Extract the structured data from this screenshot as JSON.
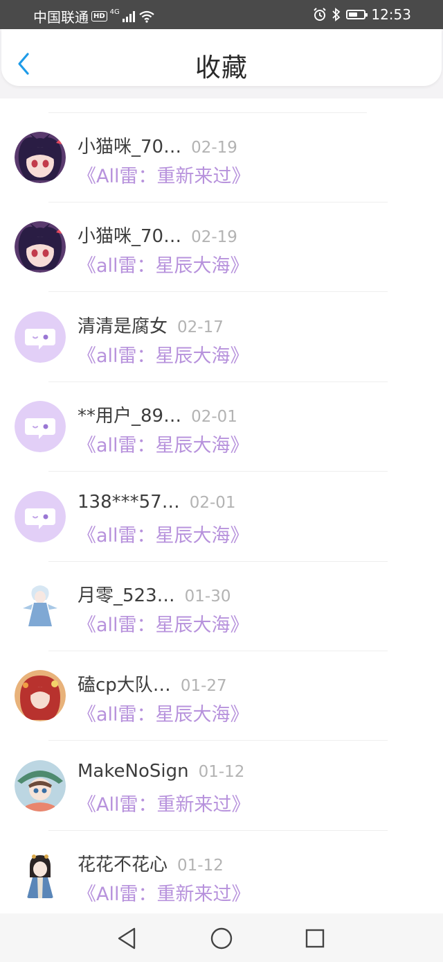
{
  "status_bar": {
    "carrier": "中国联通",
    "hd_badge": "HD",
    "network_type": "4G",
    "time": "12:53",
    "icons": [
      "signal-icon",
      "wifi-icon",
      "alarm-icon",
      "bluetooth-icon",
      "battery-icon"
    ]
  },
  "header": {
    "title": "收藏",
    "back_icon": "chevron-left-icon",
    "accent_color": "#1e9be8"
  },
  "colors": {
    "name": "#3d3d3d",
    "date": "#b3b3b3",
    "item_title": "#b792dc",
    "default_avatar_bg": "#e2cff7"
  },
  "items": [
    {
      "name": "小猫咪_70…",
      "date": "02-19",
      "title": "《All雷：重新来过》",
      "avatar": "anime-cat-girl-avatar"
    },
    {
      "name": "小猫咪_70…",
      "date": "02-19",
      "title": "《all雷：星辰大海》",
      "avatar": "anime-cat-girl-avatar"
    },
    {
      "name": "清清是腐女",
      "date": "02-17",
      "title": "《all雷：星辰大海》",
      "avatar": "default-chat-avatar"
    },
    {
      "name": "**用户_89…",
      "date": "02-01",
      "title": "《all雷：星辰大海》",
      "avatar": "default-chat-avatar"
    },
    {
      "name": "138***57…",
      "date": "02-01",
      "title": "《all雷：星辰大海》",
      "avatar": "default-chat-avatar"
    },
    {
      "name": "月零_523…",
      "date": "01-30",
      "title": "《all雷：星辰大海》",
      "avatar": "chibi-blue-robe-avatar"
    },
    {
      "name": "磕cp大队…",
      "date": "01-27",
      "title": "《all雷：星辰大海》",
      "avatar": "red-hair-girl-avatar"
    },
    {
      "name": "MakeNoSign",
      "date": "01-12",
      "title": "《All雷：重新来过》",
      "avatar": "boy-with-hat-avatar"
    },
    {
      "name": "花花不花心",
      "date": "01-12",
      "title": "《All雷：重新来过》",
      "avatar": "chibi-hanfu-avatar"
    }
  ],
  "nav_bar": {
    "buttons": [
      "back-triangle-icon",
      "home-circle-icon",
      "recents-square-icon"
    ]
  }
}
